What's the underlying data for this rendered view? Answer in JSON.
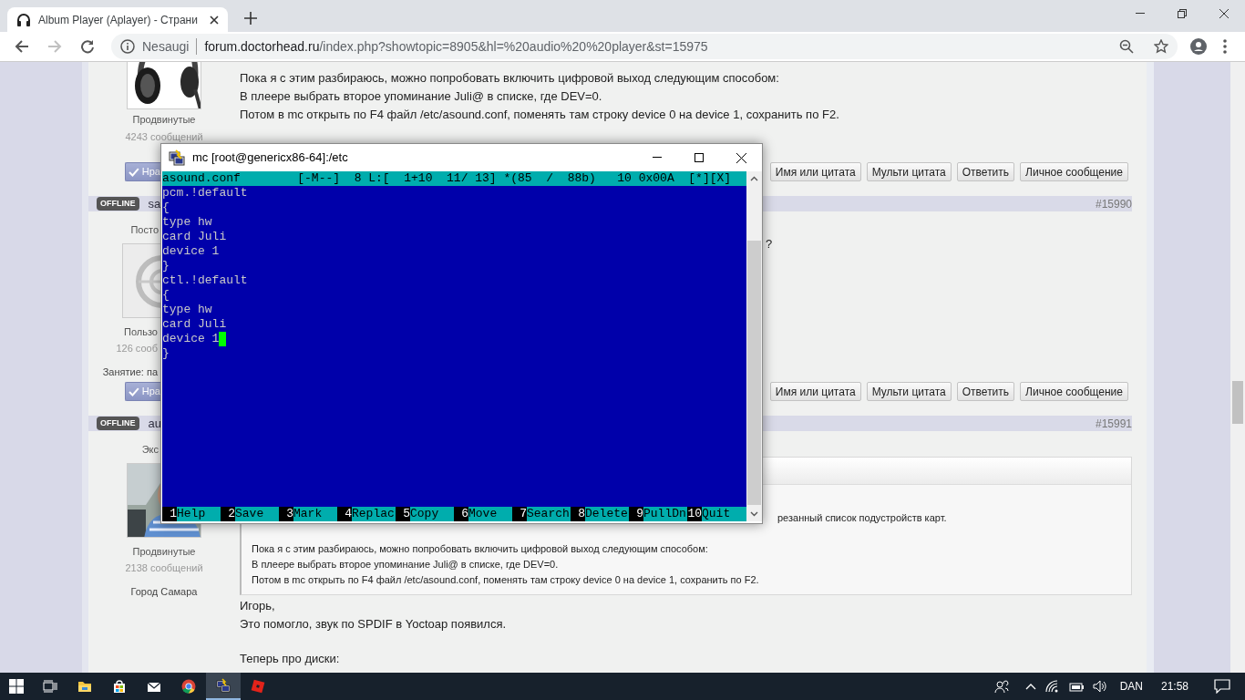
{
  "browser": {
    "tab": {
      "title": "Album Player (Aplayer) - Страни",
      "selected": true
    },
    "nav": {
      "forward_disabled": true
    },
    "address": {
      "security": "Nesaugi",
      "domain": "forum.doctorhead.ru",
      "path": "/index.php?showtopic=8905&hl=%20audio%20%20player&st=15975"
    }
  },
  "posts": [
    {
      "author": {
        "details": [
          {
            "kind": "group",
            "text": "Продвинутые"
          },
          {
            "kind": "count",
            "text": "4243 сообщений"
          }
        ]
      },
      "body": [
        {
          "kind": "line",
          "text": "Пока я с этим разбираюсь, можно попробовать включить цифровой выход следующим способом:"
        },
        {
          "kind": "line",
          "text": "В плеере выбрать второе упоминание Juli@ в списке, где DEV=0."
        },
        {
          "kind": "line",
          "text": "Потом в mc открыть по F4 файл /etc/asound.conf, поменять там строку device 0 на device 1, сохранить по F2."
        }
      ],
      "actions": {
        "like": "Нра",
        "buttons": [
          "Имя или цитата",
          "Мульти цитата",
          "Ответить",
          "Личное сообщение"
        ]
      }
    },
    {
      "header": {
        "status": "OFFLINE",
        "name": "sa",
        "number": "#15990"
      },
      "author": {
        "rank": "Посто",
        "details": [
          {
            "kind": "group",
            "text": "Пользо"
          },
          {
            "kind": "count",
            "text": "126 сооб"
          },
          {
            "kind": "info",
            "text": "Занятие: па"
          }
        ]
      },
      "body": [
        {
          "kind": "clipped",
          "text": "?"
        }
      ],
      "actions": {
        "like": "Нра",
        "buttons": [
          "Имя или цитата",
          "Мульти цитата",
          "Ответить",
          "Личное сообщение"
        ]
      }
    },
    {
      "header": {
        "status": "OFFLINE",
        "name": "au",
        "number": "#15991"
      },
      "author": {
        "rank": "Экс",
        "details": [
          {
            "kind": "group",
            "text": "Продвинутые"
          },
          {
            "kind": "count",
            "text": "2138 сообщений"
          },
          {
            "kind": "info",
            "text": "Город Самара"
          }
        ]
      },
      "body": [
        {
          "kind": "quote",
          "lines": [
            {
              "kind": "clipped",
              "text": "резанный список подустройств карт."
            },
            {
              "kind": "paragraph",
              "text": "Пока я с этим разбираюсь, можно попробовать включить цифровой выход следующим способом:"
            },
            {
              "kind": "line",
              "text": "В плеере выбрать второе упоминание Juli@ в списке, где DEV=0."
            },
            {
              "kind": "line",
              "text": "Потом в mc открыть по F4 файл /etc/asound.conf, поменять там строку device 0 на device 1, сохранить по F2."
            }
          ]
        },
        {
          "kind": "line",
          "text": "Игорь,"
        },
        {
          "kind": "line",
          "text": "Это помогло, звук по SPDIF в Yoctoap появился."
        },
        {
          "kind": "paragraph",
          "text": "Теперь про диски:"
        }
      ]
    }
  ],
  "mc_window": {
    "title": "mc [root@genericx86-64]:/etc",
    "status_line": "asound.conf        [-M--]  8 L:[  1+10  11/ 13] *(85  /  88b)   10 0x00A  [*][X]",
    "lines": [
      {
        "text": "pcm.!default",
        "cursor": false
      },
      {
        "text": "{",
        "cursor": false
      },
      {
        "text": "type hw",
        "cursor": false
      },
      {
        "text": "card Juli",
        "cursor": false
      },
      {
        "text": "device 1",
        "cursor": false
      },
      {
        "text": "}",
        "cursor": false
      },
      {
        "text": "ctl.!default",
        "cursor": false
      },
      {
        "text": "{",
        "cursor": false
      },
      {
        "text": "type hw",
        "cursor": false
      },
      {
        "text": "card Juli",
        "cursor": false
      },
      {
        "text": "device 1",
        "cursor": true
      },
      {
        "text": "}",
        "cursor": false
      }
    ],
    "keys": [
      {
        "num": "1",
        "label": "Help"
      },
      {
        "num": "2",
        "label": "Save"
      },
      {
        "num": "3",
        "label": "Mark"
      },
      {
        "num": "4",
        "label": "Replac"
      },
      {
        "num": "5",
        "label": "Copy"
      },
      {
        "num": "6",
        "label": "Move"
      },
      {
        "num": "7",
        "label": "Search"
      },
      {
        "num": "8",
        "label": "Delete"
      },
      {
        "num": "9",
        "label": "PullDn"
      },
      {
        "num": "10",
        "label": "Quit"
      }
    ]
  },
  "taskbar": {
    "apps": [
      {
        "kind": "explorer",
        "active": false
      },
      {
        "kind": "store",
        "active": false
      },
      {
        "kind": "mail",
        "active": false
      },
      {
        "kind": "chrome",
        "active": false
      },
      {
        "kind": "putty",
        "active": true
      },
      {
        "kind": "roblox",
        "active": false
      }
    ],
    "language": "DAN",
    "time": "21:58"
  }
}
